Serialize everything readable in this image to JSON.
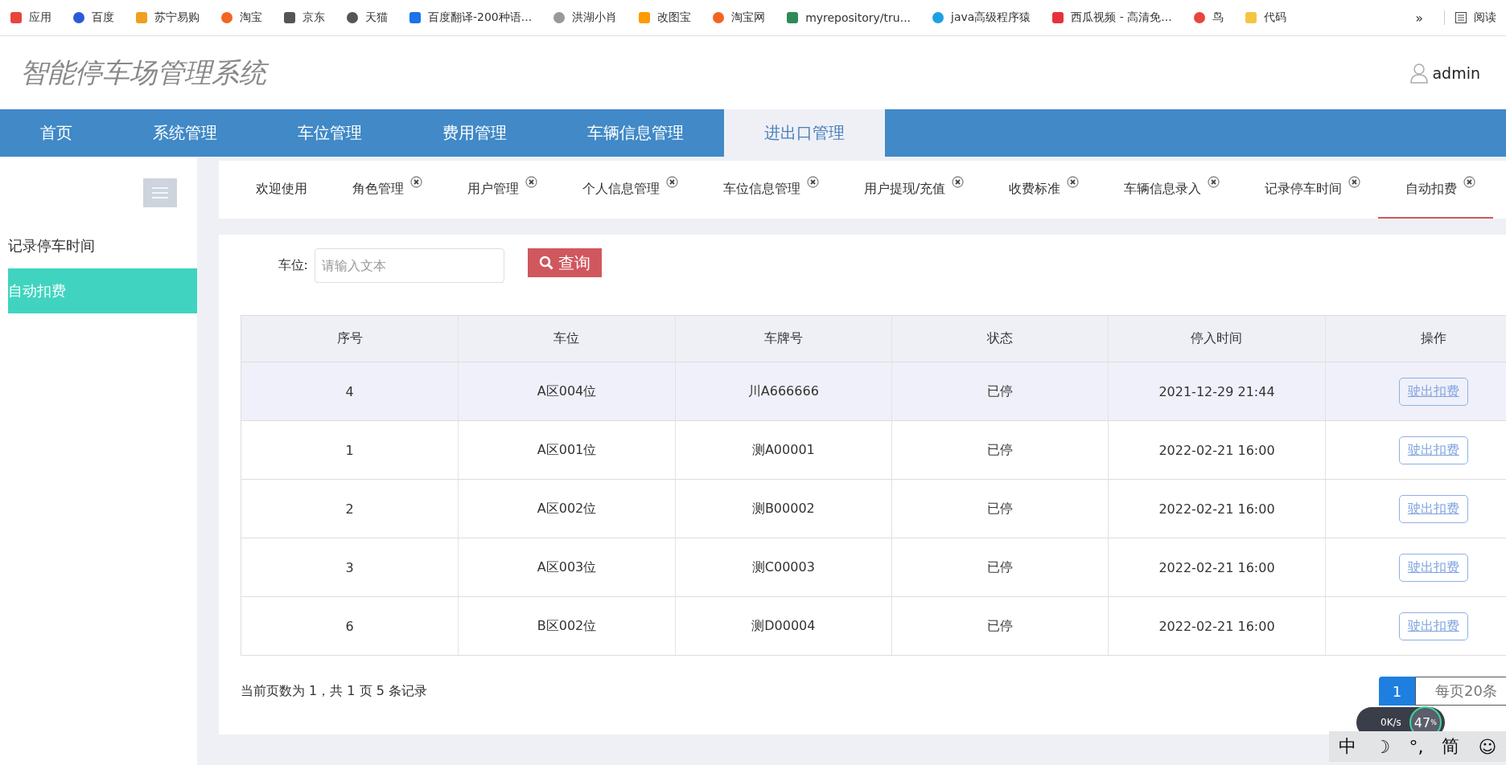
{
  "bookmarks": [
    {
      "label": "应用"
    },
    {
      "label": "百度"
    },
    {
      "label": "苏宁易购"
    },
    {
      "label": "淘宝"
    },
    {
      "label": "京东"
    },
    {
      "label": "天猫"
    },
    {
      "label": "百度翻译-200种语..."
    },
    {
      "label": "洪湖小肖"
    },
    {
      "label": "改图宝"
    },
    {
      "label": "淘宝网"
    },
    {
      "label": "myrepository/tru..."
    },
    {
      "label": "java高级程序猿"
    },
    {
      "label": "西瓜视频 - 高清免..."
    },
    {
      "label": "鸟"
    },
    {
      "label": "代码"
    }
  ],
  "bookmarks_more": "»",
  "reading_list": "阅读",
  "header": {
    "title": "智能停车场管理系统",
    "user": "admin"
  },
  "nav": [
    {
      "label": "首页",
      "selected": false
    },
    {
      "label": "系统管理",
      "selected": false
    },
    {
      "label": "车位管理",
      "selected": false
    },
    {
      "label": "费用管理",
      "selected": false
    },
    {
      "label": "车辆信息管理",
      "selected": false
    },
    {
      "label": "进出口管理",
      "selected": true
    }
  ],
  "sidebar": {
    "items": [
      {
        "label": "记录停车时间",
        "selected": false
      },
      {
        "label": "自动扣费",
        "selected": true
      }
    ]
  },
  "tabs": [
    {
      "label": "欢迎使用",
      "closable": false,
      "selected": false
    },
    {
      "label": "角色管理",
      "closable": true,
      "selected": false
    },
    {
      "label": "用户管理",
      "closable": true,
      "selected": false
    },
    {
      "label": "个人信息管理",
      "closable": true,
      "selected": false
    },
    {
      "label": "车位信息管理",
      "closable": true,
      "selected": false
    },
    {
      "label": "用户提现/充值",
      "closable": true,
      "selected": false
    },
    {
      "label": "收费标准",
      "closable": true,
      "selected": false
    },
    {
      "label": "车辆信息录入",
      "closable": true,
      "selected": false
    },
    {
      "label": "记录停车时间",
      "closable": true,
      "selected": false
    },
    {
      "label": "自动扣费",
      "closable": true,
      "selected": true
    }
  ],
  "search": {
    "label": "车位:",
    "placeholder": "请输入文本",
    "button": "查询"
  },
  "table": {
    "columns": [
      "序号",
      "车位",
      "车牌号",
      "状态",
      "停入时间",
      "操作"
    ],
    "rows": [
      {
        "cells": [
          "4",
          "A区004位",
          "川A666666",
          "已停",
          "2021-12-29 21:44"
        ],
        "action": "驶出扣费",
        "selected": true
      },
      {
        "cells": [
          "1",
          "A区001位",
          "测A00001",
          "已停",
          "2022-02-21 16:00"
        ],
        "action": "驶出扣费",
        "selected": false
      },
      {
        "cells": [
          "2",
          "A区002位",
          "测B00002",
          "已停",
          "2022-02-21 16:00"
        ],
        "action": "驶出扣费",
        "selected": false
      },
      {
        "cells": [
          "3",
          "A区003位",
          "测C00003",
          "已停",
          "2022-02-21 16:00"
        ],
        "action": "驶出扣费",
        "selected": false
      },
      {
        "cells": [
          "6",
          "B区002位",
          "测D00004",
          "已停",
          "2022-02-21 16:00"
        ],
        "action": "驶出扣费",
        "selected": false
      }
    ]
  },
  "footer": {
    "summary": "当前页数为 1，共 1 页  5 条记录",
    "page": "1",
    "page_size": "每页20条"
  },
  "speed_widget": {
    "speed": "0K/s",
    "percent": "47",
    "unit": "%"
  },
  "ime_bar": [
    "中",
    "☽",
    "°,",
    "简",
    "☺"
  ]
}
